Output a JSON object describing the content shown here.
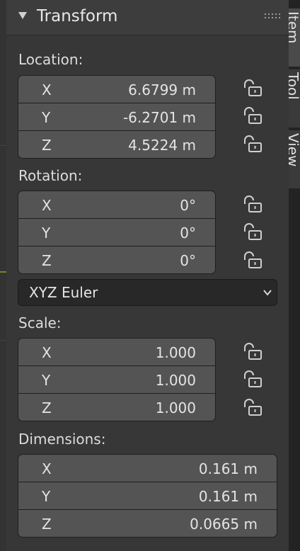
{
  "panel": {
    "title": "Transform"
  },
  "location": {
    "label": "Location:",
    "rows": [
      {
        "axis": "X",
        "value": "6.6799 m"
      },
      {
        "axis": "Y",
        "value": "-6.2701 m"
      },
      {
        "axis": "Z",
        "value": "4.5224 m"
      }
    ]
  },
  "rotation": {
    "label": "Rotation:",
    "rows": [
      {
        "axis": "X",
        "value": "0°"
      },
      {
        "axis": "Y",
        "value": "0°"
      },
      {
        "axis": "Z",
        "value": "0°"
      }
    ],
    "mode": "XYZ Euler"
  },
  "scale": {
    "label": "Scale:",
    "rows": [
      {
        "axis": "X",
        "value": "1.000"
      },
      {
        "axis": "Y",
        "value": "1.000"
      },
      {
        "axis": "Z",
        "value": "1.000"
      }
    ]
  },
  "dimensions": {
    "label": "Dimensions:",
    "rows": [
      {
        "axis": "X",
        "value": "0.161 m"
      },
      {
        "axis": "Y",
        "value": "0.161 m"
      },
      {
        "axis": "Z",
        "value": "0.0665 m"
      }
    ]
  },
  "sidebar_tabs": [
    {
      "label": "Item",
      "active": true
    },
    {
      "label": "Tool",
      "active": false
    },
    {
      "label": "View",
      "active": false
    }
  ],
  "icons": {
    "collapse": "triangle-down-icon",
    "drag": "grip-icon",
    "lock": "unlocked-padlock-icon",
    "dropdown": "chevron-down-icon"
  },
  "colors": {
    "field": "#545454",
    "panel_bg": "#373737",
    "header_bg": "#3d3d3d",
    "text": "#e4e4e4"
  }
}
